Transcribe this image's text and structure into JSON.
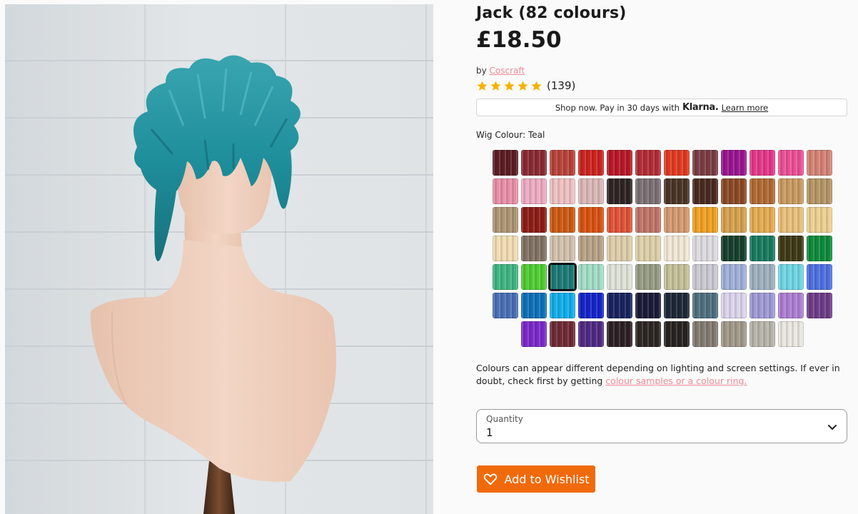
{
  "product": {
    "title": "Jack (82 colours)",
    "price": "£18.50",
    "by_prefix": "by",
    "brand": "Coscraft",
    "rating_stars": 5,
    "rating_count": "(139)"
  },
  "klarna": {
    "text": "Shop now. Pay in 30 days with",
    "brand": "Klarna.",
    "learn_more": "Learn more"
  },
  "colour": {
    "label": "Wig Colour: Teal",
    "selected_index": 50,
    "swatches": [
      "#5c1e24",
      "#8a2a33",
      "#b8433a",
      "#cc2420",
      "#b81827",
      "#b22c36",
      "#e03a22",
      "#7a3d43",
      "#9a1590",
      "#e4388a",
      "#ec4f95",
      "#d48276",
      "#e88fa8",
      "#eeabc2",
      "#eec1c2",
      "#d9b8b7",
      "#2e2523",
      "#7b7175",
      "#4a3427",
      "#4a2a20",
      "#8a4a26",
      "#b06a34",
      "#c99a60",
      "#b59565",
      "#ad9574",
      "#8c1d16",
      "#cc5a14",
      "#d85212",
      "#df5437",
      "#c07468",
      "#d49a70",
      "#f0a024",
      "#d6a04e",
      "#e4ab52",
      "#e8c07a",
      "#edcf90",
      "#f1dcb3",
      "#827264",
      "#d1c1ac",
      "#b7a286",
      "#ddcda8",
      "#dccfa8",
      "#f2e8d6",
      "#dedbe0",
      "#17402e",
      "#1a7a5f",
      "#3f3a16",
      "#0e8a3a",
      "#40b582",
      "#4fcc32",
      "#1e7a76",
      "#a3ddc6",
      "#dfe2d8",
      "#959c82",
      "#c4c098",
      "#cbcad2",
      "#9fb0d8",
      "#9eb0bd",
      "#6fd6e4",
      "#4f70e0",
      "#4a6fb4",
      "#0e70b8",
      "#12aeea",
      "#1525c8",
      "#1a2460",
      "#1c1b38",
      "#1e2838",
      "#4f6f7e",
      "#dcd4ea",
      "#9e9ad4",
      "#ac7ed2",
      "#6e3c88",
      "#7a2ac8",
      "#6e2a36",
      "#4f2a82",
      "#2c2024",
      "#2c2722",
      "#262321",
      "#827b72",
      "#a0998a",
      "#b7b5aa",
      "#e9e7e0"
    ]
  },
  "note": {
    "text": "Colours can appear different depending on lighting and screen settings. If ever in doubt, check first by getting ",
    "link": "colour samples or a colour ring."
  },
  "quantity": {
    "label": "Quantity",
    "value": "1"
  },
  "wishlist": {
    "label": "Add to Wishlist"
  },
  "colors": {
    "accent": "#f06a0c",
    "link": "#f08a94",
    "star": "#f5b301"
  }
}
